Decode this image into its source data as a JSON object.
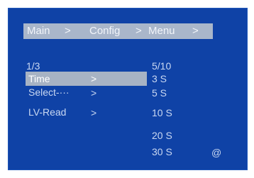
{
  "breadcrumb": {
    "main": "Main",
    "sep1": ">",
    "config": "Config",
    "sep2": ">",
    "menu": "Menu",
    "sep3": ">"
  },
  "menu": {
    "page_indicator": "1/3",
    "items": [
      {
        "label": "Time",
        "arrow": ">"
      },
      {
        "label": "Select-···",
        "arrow": ">"
      },
      {
        "label": "LV-Read",
        "arrow": ">"
      }
    ]
  },
  "values": {
    "position": "5/10",
    "options": [
      "3 S",
      "5 S",
      "10 S",
      "20 S",
      "30 S"
    ],
    "cursor_symbol": "@"
  },
  "colors": {
    "panel_background": "#0f42a6",
    "highlight": "#a7b3c4",
    "text": "#c9d8f2"
  }
}
